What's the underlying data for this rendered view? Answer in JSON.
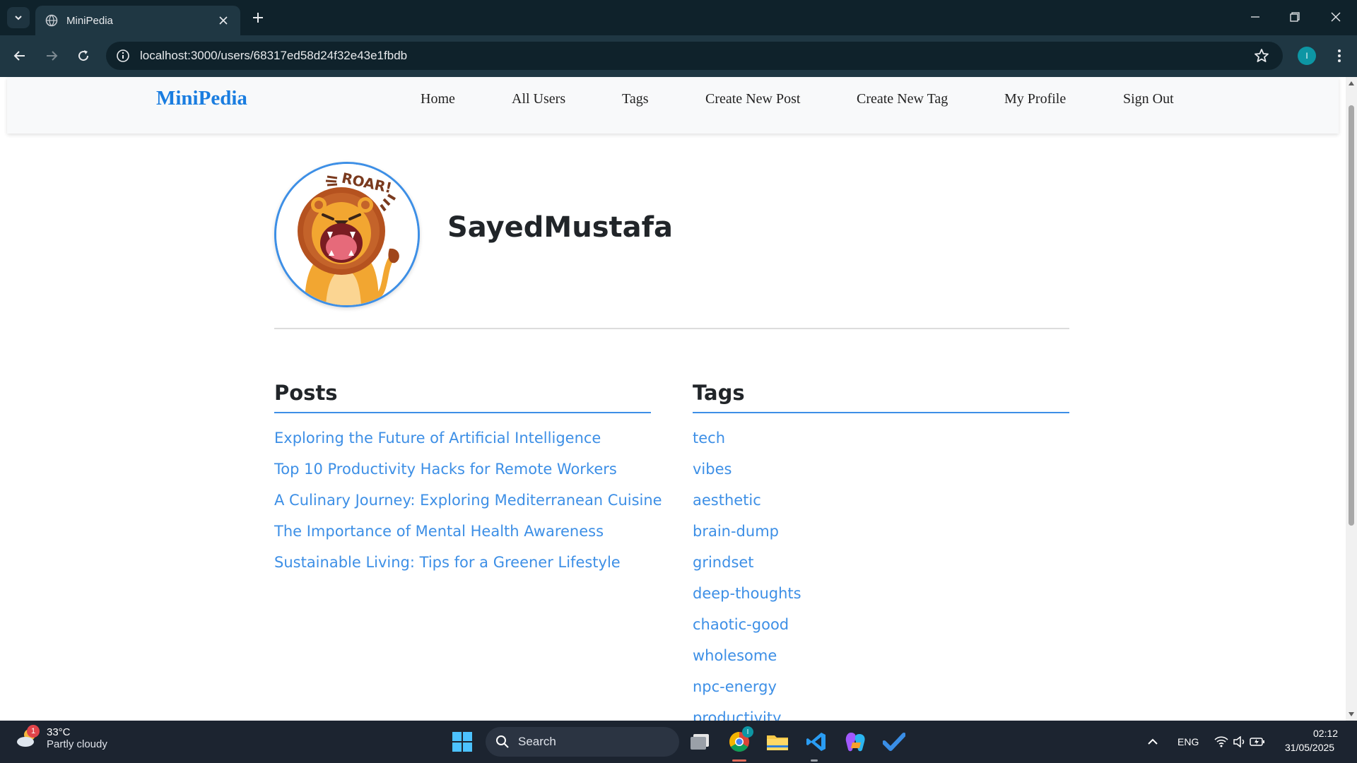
{
  "browser": {
    "tab_title": "MiniPedia",
    "url": "localhost:3000/users/68317ed58d24f32e43e1fbdb",
    "profile_initial": "I"
  },
  "site": {
    "brand": "MiniPedia",
    "nav": [
      "Home",
      "All Users",
      "Tags",
      "Create New Post",
      "Create New Tag",
      "My Profile",
      "Sign Out"
    ]
  },
  "profile": {
    "username": "SayedMustafa",
    "avatar_text": "ROAR!"
  },
  "posts": {
    "title": "Posts",
    "items": [
      "Exploring the Future of Artificial Intelligence",
      "Top 10 Productivity Hacks for Remote Workers",
      "A Culinary Journey: Exploring Mediterranean Cuisine",
      "The Importance of Mental Health Awareness",
      "Sustainable Living: Tips for a Greener Lifestyle"
    ]
  },
  "tags": {
    "title": "Tags",
    "items": [
      "tech",
      "vibes",
      "aesthetic",
      "brain-dump",
      "grindset",
      "deep-thoughts",
      "chaotic-good",
      "wholesome",
      "npc-energy",
      "productivity"
    ]
  },
  "taskbar": {
    "weather_temp": "33°C",
    "weather_cond": "Partly cloudy",
    "weather_badge": "1",
    "search_placeholder": "Search",
    "language": "ENG",
    "time": "02:12",
    "date": "31/05/2025",
    "chrome_badge": "I"
  },
  "colors": {
    "accent": "#3d8fe6",
    "brand": "#1a7de0",
    "chrome_dark": "#0f222b",
    "chrome_toolbar": "#1f3743"
  }
}
